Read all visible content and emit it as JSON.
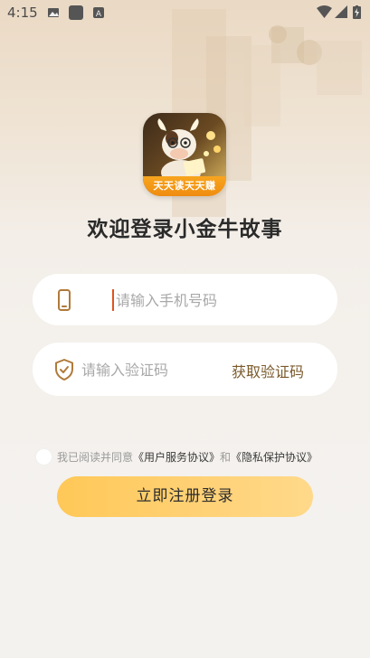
{
  "status_bar": {
    "time": "4:15",
    "left_icons": [
      "image-icon",
      "square-app-icon",
      "a-font-icon"
    ],
    "right_icons": [
      "wifi-icon",
      "signal-icon",
      "battery-charging-icon"
    ]
  },
  "logo": {
    "banner_text": "天天读天天赚"
  },
  "title": "欢迎登录小金牛故事",
  "phone_field": {
    "placeholder": "请输入手机号码",
    "icon": "phone-icon"
  },
  "code_field": {
    "placeholder": "请输入验证码",
    "icon": "shield-check-icon",
    "get_code_label": "获取验证码"
  },
  "agreement": {
    "prefix": "我已阅读并同意",
    "user_agreement": "《用户服务协议》",
    "conjunction": "和",
    "privacy_policy": "《隐私保护协议》",
    "checked": false
  },
  "submit_label": "立即注册登录",
  "colors": {
    "accent": "#ffc857",
    "link": "#3a3a3a",
    "cursor": "#e0551f",
    "icon": "#b07a3a"
  }
}
